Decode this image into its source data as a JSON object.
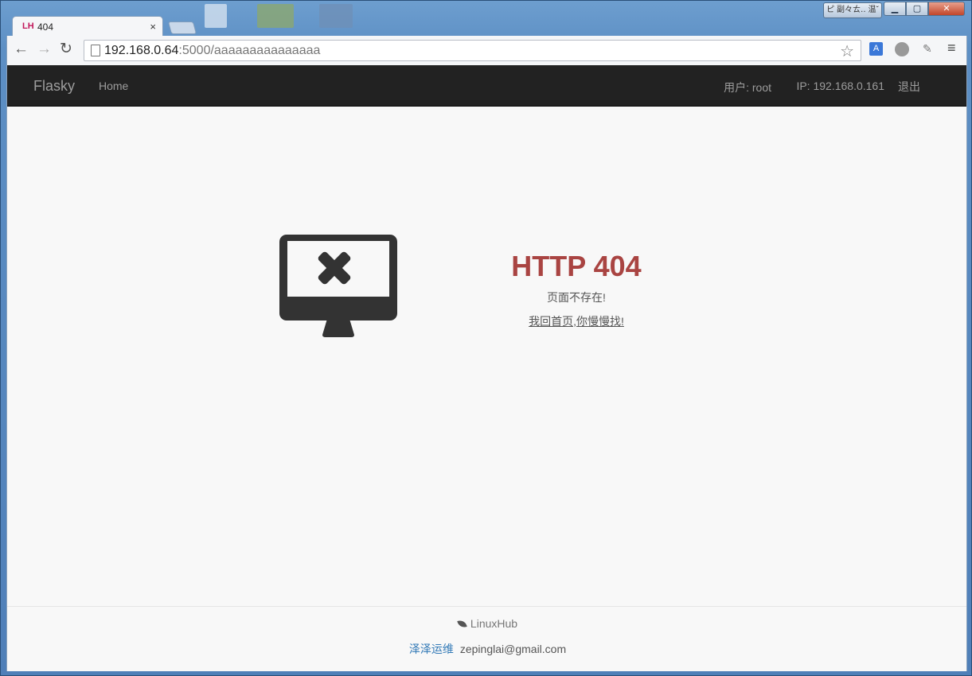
{
  "browser": {
    "tab_favicon": "LH",
    "tab_title": "404",
    "tab_close": "×",
    "url_host": "192.168.0.64",
    "url_rest": ":5000/aaaaaaaaaaaaaaa",
    "window_lang": "ピ 副々ㄊ‥ 温ˇ"
  },
  "navbar": {
    "brand": "Flasky",
    "home": "Home",
    "user": "用户: root",
    "ip": "IP: 192.168.0.161",
    "logout": "退出"
  },
  "error": {
    "title": "HTTP 404",
    "message": "页面不存在!",
    "link": "我回首页,你慢慢找!"
  },
  "footer": {
    "brand": "LinuxHub",
    "author": "泽泽运维",
    "email": "zepinglai@gmail.com"
  },
  "colors": {
    "navbar_bg": "#222222",
    "error_title": "#a94442",
    "link_blue": "#337ab7"
  }
}
